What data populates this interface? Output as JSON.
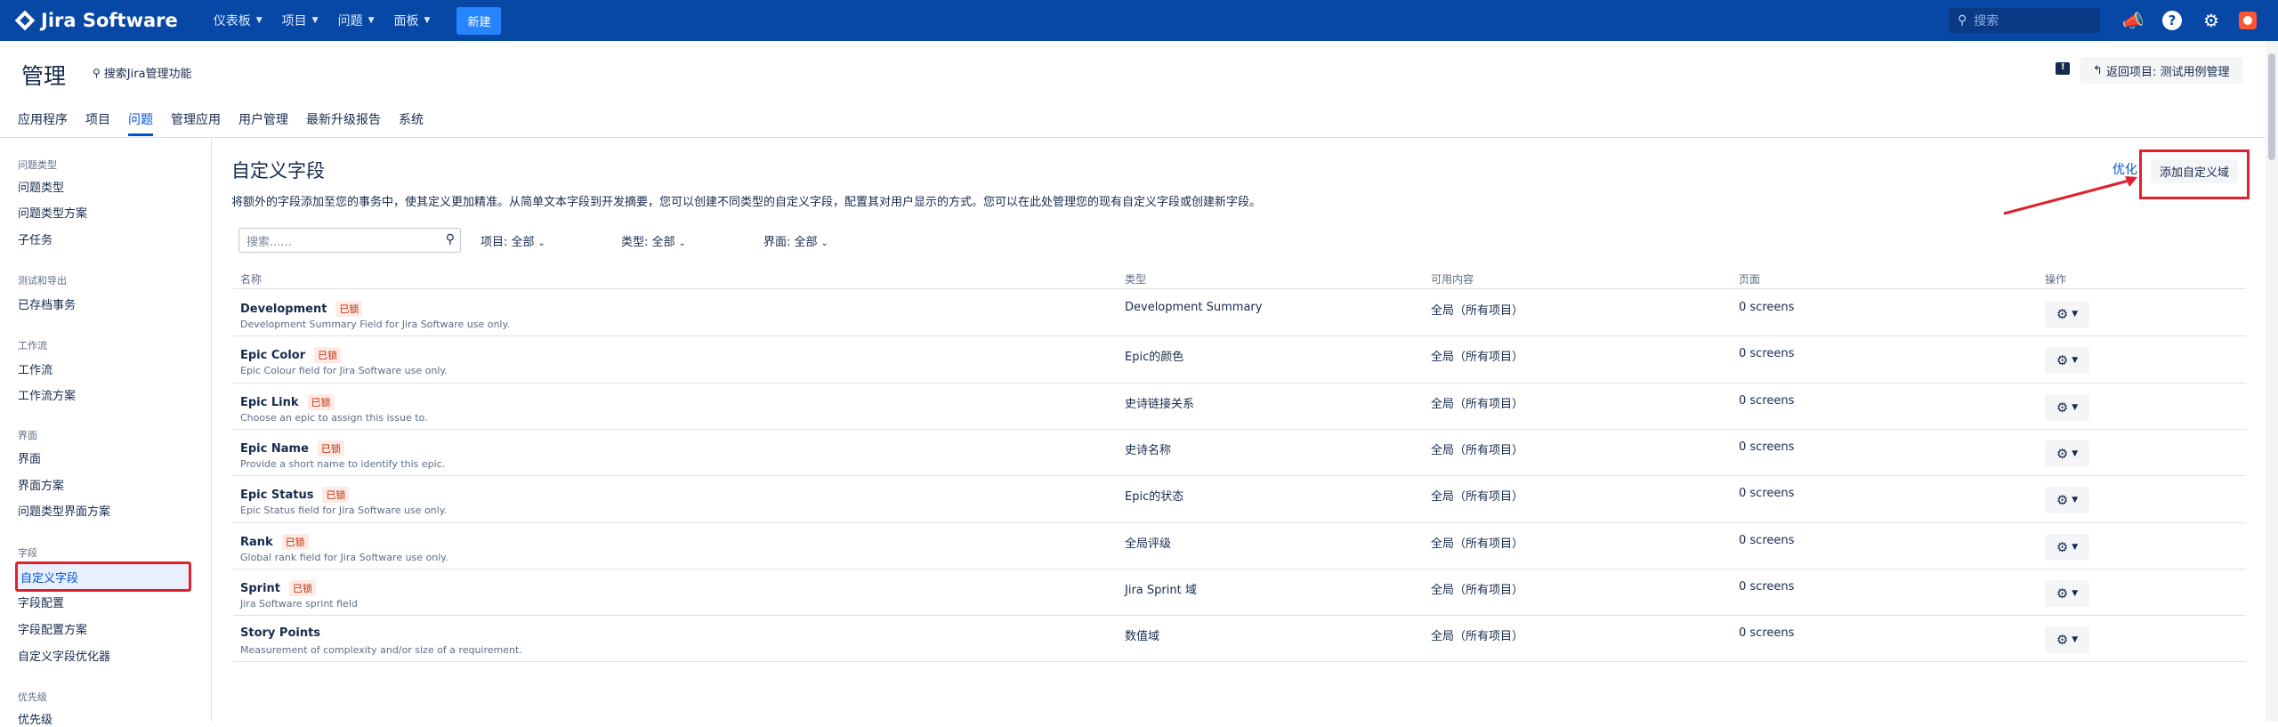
{
  "topnav": {
    "logo": "Jira Software",
    "items": [
      {
        "label": "仪表板"
      },
      {
        "label": "项目"
      },
      {
        "label": "问题"
      },
      {
        "label": "面板"
      }
    ],
    "create_label": "新建",
    "search_placeholder": "搜索"
  },
  "admin": {
    "title": "管理",
    "search_label": "搜索Jira管理功能",
    "return_label": "返回项目: 测试用例管理"
  },
  "tabs": [
    {
      "label": "应用程序"
    },
    {
      "label": "项目"
    },
    {
      "label": "问题"
    },
    {
      "label": "管理应用"
    },
    {
      "label": "用户管理"
    },
    {
      "label": "最新升级报告"
    },
    {
      "label": "系统"
    }
  ],
  "sidebar": {
    "groups": [
      {
        "title": "问题类型",
        "items": [
          "问题类型",
          "问题类型方案",
          "子任务"
        ]
      },
      {
        "title": "测试和导出",
        "items": [
          "已存档事务"
        ]
      },
      {
        "title": "工作流",
        "items": [
          "工作流",
          "工作流方案"
        ]
      },
      {
        "title": "界面",
        "items": [
          "界面",
          "界面方案",
          "问题类型界面方案"
        ]
      },
      {
        "title": "字段",
        "items": [
          "自定义字段",
          "字段配置",
          "字段配置方案",
          "自定义字段优化器"
        ]
      },
      {
        "title": "优先级",
        "items": [
          "优先级"
        ]
      }
    ]
  },
  "main": {
    "title": "自定义字段",
    "optimize_label": "优化",
    "add_label": "添加自定义域",
    "description": "将额外的字段添加至您的事务中，使其定义更加精准。从简单文本字段到开发摘要，您可以创建不同类型的自定义字段，配置其对用户显示的方式。您可以在此处管理您的现有自定义字段或创建新字段。",
    "filter_placeholder": "搜索......",
    "filters": [
      "项目: 全部",
      "类型: 全部",
      "界面: 全部"
    ],
    "columns": [
      "名称",
      "类型",
      "可用内容",
      "页面",
      "操作"
    ],
    "locked_label": "已锁",
    "rows": [
      {
        "name": "Development",
        "locked": true,
        "desc": "Development Summary Field for Jira Software use only.",
        "type": "Development Summary",
        "context": "全局（所有项目）",
        "screens": "0 screens"
      },
      {
        "name": "Epic Color",
        "locked": true,
        "desc": "Epic Colour field for Jira Software use only.",
        "type": "Epic的颜色",
        "context": "全局（所有项目）",
        "screens": "0 screens"
      },
      {
        "name": "Epic Link",
        "locked": true,
        "desc": "Choose an epic to assign this issue to.",
        "type": "史诗链接关系",
        "context": "全局（所有项目）",
        "screens": "0 screens"
      },
      {
        "name": "Epic Name",
        "locked": true,
        "desc": "Provide a short name to identify this epic.",
        "type": "史诗名称",
        "context": "全局（所有项目）",
        "screens": "0 screens"
      },
      {
        "name": "Epic Status",
        "locked": true,
        "desc": "Epic Status field for Jira Software use only.",
        "type": "Epic的状态",
        "context": "全局（所有项目）",
        "screens": "0 screens"
      },
      {
        "name": "Rank",
        "locked": true,
        "desc": "Global rank field for Jira Software use only.",
        "type": "全局评级",
        "context": "全局（所有项目）",
        "screens": "0 screens"
      },
      {
        "name": "Sprint",
        "locked": true,
        "desc": "Jira Software sprint field",
        "type": "Jira Sprint 域",
        "context": "全局（所有项目）",
        "screens": "0 screens"
      },
      {
        "name": "Story Points",
        "locked": false,
        "desc": "Measurement of complexity and/or size of a requirement.",
        "type": "数值域",
        "context": "全局（所有项目）",
        "screens": "0 screens"
      }
    ]
  },
  "colors": {
    "nav": "#0747a6",
    "accent": "#0052cc",
    "highlight": "#e0202c"
  }
}
